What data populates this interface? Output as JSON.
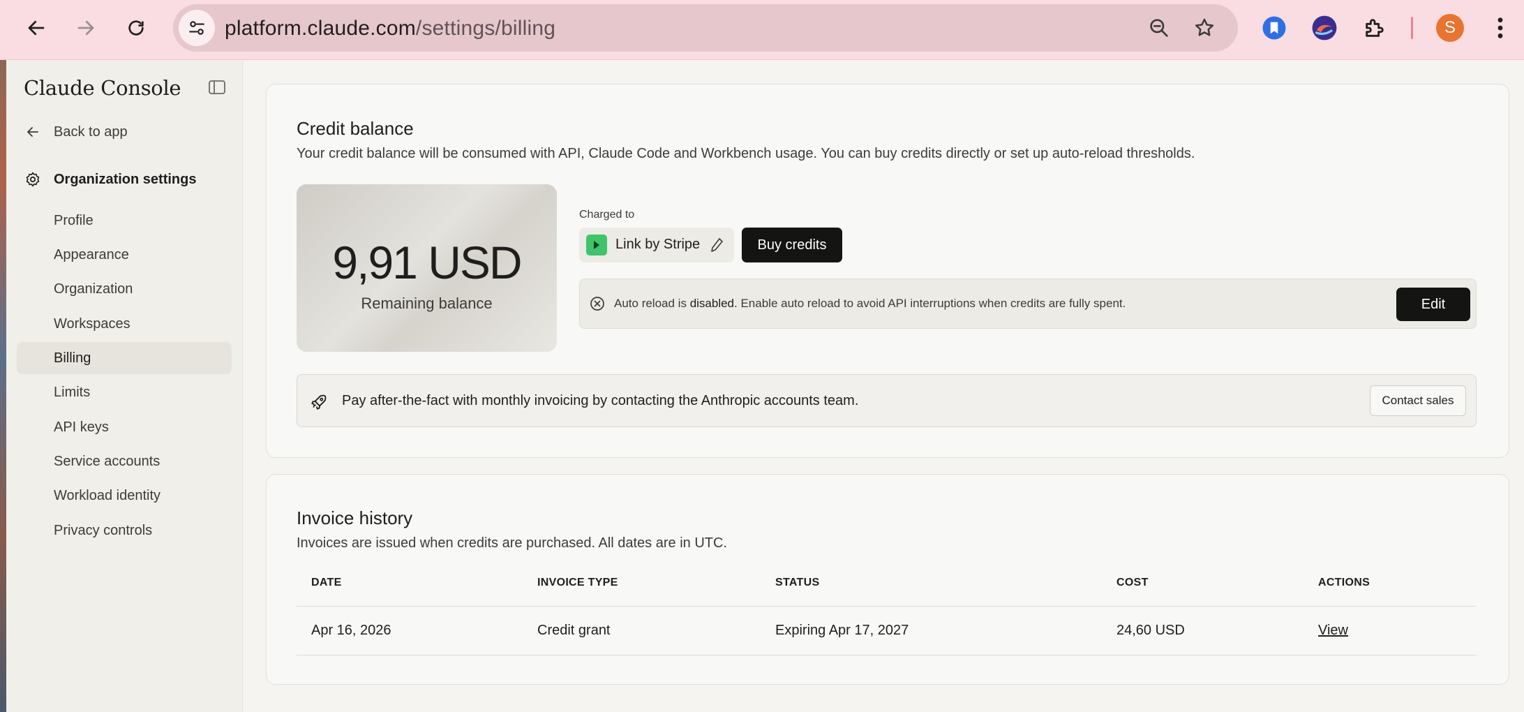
{
  "browser": {
    "url_host": "platform.claude.com",
    "url_path": "/settings/billing",
    "avatar_letter": "S"
  },
  "sidebar": {
    "brand": "Claude Console",
    "back_label": "Back to app",
    "section_label": "Organization settings",
    "items": [
      {
        "label": "Profile"
      },
      {
        "label": "Appearance"
      },
      {
        "label": "Organization"
      },
      {
        "label": "Workspaces"
      },
      {
        "label": "Billing"
      },
      {
        "label": "Limits"
      },
      {
        "label": "API keys"
      },
      {
        "label": "Service accounts"
      },
      {
        "label": "Workload identity"
      },
      {
        "label": "Privacy controls"
      }
    ],
    "active_item": "Billing"
  },
  "credit": {
    "title": "Credit balance",
    "description": "Your credit balance will be consumed with API, Claude Code and Workbench usage. You can buy credits directly or set up auto-reload thresholds.",
    "amount": "9,91 USD",
    "amount_label": "Remaining balance",
    "charged_to_label": "Charged to",
    "payment_method": "Link by Stripe",
    "buy_label": "Buy credits",
    "auto_reload_prefix": "Auto reload is ",
    "auto_reload_status": "disabled",
    "auto_reload_suffix": ". Enable auto reload to avoid API interruptions when credits are fully spent.",
    "edit_label": "Edit",
    "invoicing_text": "Pay after-the-fact with monthly invoicing by contacting the Anthropic accounts team.",
    "contact_label": "Contact sales"
  },
  "invoices": {
    "title": "Invoice history",
    "description": "Invoices are issued when credits are purchased. All dates are in UTC.",
    "columns": [
      "DATE",
      "INVOICE TYPE",
      "STATUS",
      "COST",
      "ACTIONS"
    ],
    "rows": [
      {
        "date": "Apr 16, 2026",
        "type": "Credit grant",
        "status": "Expiring Apr 17, 2027",
        "cost": "24,60 USD",
        "action": "View"
      }
    ]
  },
  "colors": {
    "chrome_bg": "#f9dde2",
    "accent_dark": "#141413",
    "stripe_green": "#3fc46a",
    "avatar": "#e8742f"
  }
}
